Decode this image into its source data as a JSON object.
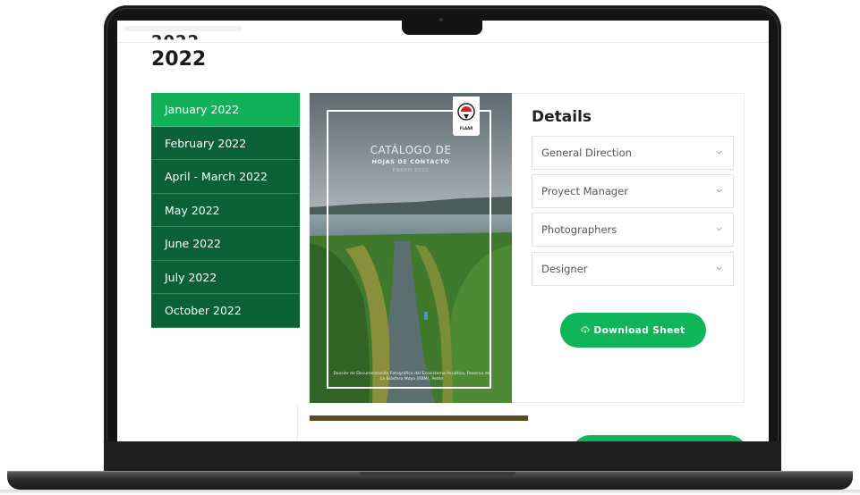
{
  "page": {
    "year_heading": "2022"
  },
  "months": [
    {
      "label": "January 2022",
      "active": true
    },
    {
      "label": "February 2022",
      "active": false
    },
    {
      "label": "April - March 2022",
      "active": false
    },
    {
      "label": "May 2022",
      "active": false
    },
    {
      "label": "June 2022",
      "active": false
    },
    {
      "label": "July 2022",
      "active": false
    },
    {
      "label": "October 2022",
      "active": false
    }
  ],
  "cover": {
    "title": "CATÁLOGO DE",
    "subtitle": "HOJAS DE CONTACTO",
    "date": "ENERO 2022",
    "logo_text": "FLAAR",
    "footer": "Dossier de Documentación Fotográfica del Ecosistema Acuático, Reserva de La Biósfera Maya (RBM), Petén"
  },
  "details": {
    "title": "Details",
    "items": [
      {
        "label": "General Direction"
      },
      {
        "label": "Proyect Manager"
      },
      {
        "label": "Photographers"
      },
      {
        "label": "Designer"
      }
    ],
    "download_label": "Download Sheet"
  },
  "colors": {
    "month_active": "#11b15a",
    "month_inactive": "#0b6136",
    "button": "#10b55a"
  },
  "icons": [
    "chevron-down-icon",
    "cloud-download-icon",
    "camera-notch",
    "flaar-logo"
  ]
}
